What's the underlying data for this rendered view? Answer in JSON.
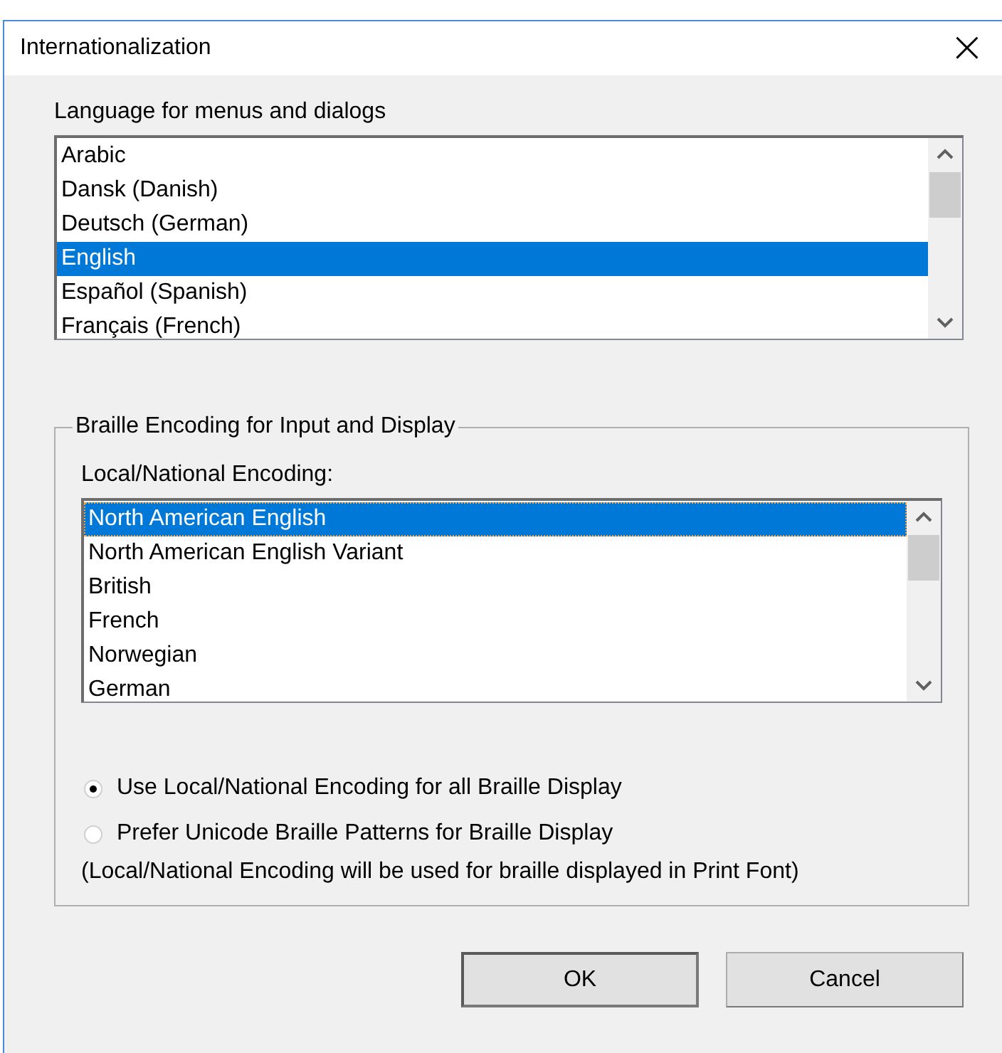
{
  "window": {
    "title": "Internationalization",
    "close": "×"
  },
  "language": {
    "label": "Language for menus and dialogs",
    "items": [
      {
        "label": "Arabic",
        "selected": false
      },
      {
        "label": "Dansk (Danish)",
        "selected": false
      },
      {
        "label": "Deutsch (German)",
        "selected": false
      },
      {
        "label": "English",
        "selected": true
      },
      {
        "label": "Español (Spanish)",
        "selected": false
      },
      {
        "label": "Français (French)",
        "selected": false
      }
    ]
  },
  "braille": {
    "title": "Braille Encoding for Input and Display",
    "label": "Local/National Encoding:",
    "items": [
      {
        "label": "North American English",
        "selected": true
      },
      {
        "label": "North American English Variant",
        "selected": false
      },
      {
        "label": "British",
        "selected": false
      },
      {
        "label": "French",
        "selected": false
      },
      {
        "label": "Norwegian",
        "selected": false
      },
      {
        "label": "German",
        "selected": false
      }
    ],
    "options": [
      {
        "label": "Use Local/National Encoding for all Braille Display",
        "selected": true
      },
      {
        "label": "Prefer Unicode Braille Patterns for Braille Display",
        "selected": false
      }
    ],
    "note": "(Local/National Encoding will be used for braille displayed in Print Font)"
  },
  "buttons": [
    "OK",
    "Cancel"
  ]
}
